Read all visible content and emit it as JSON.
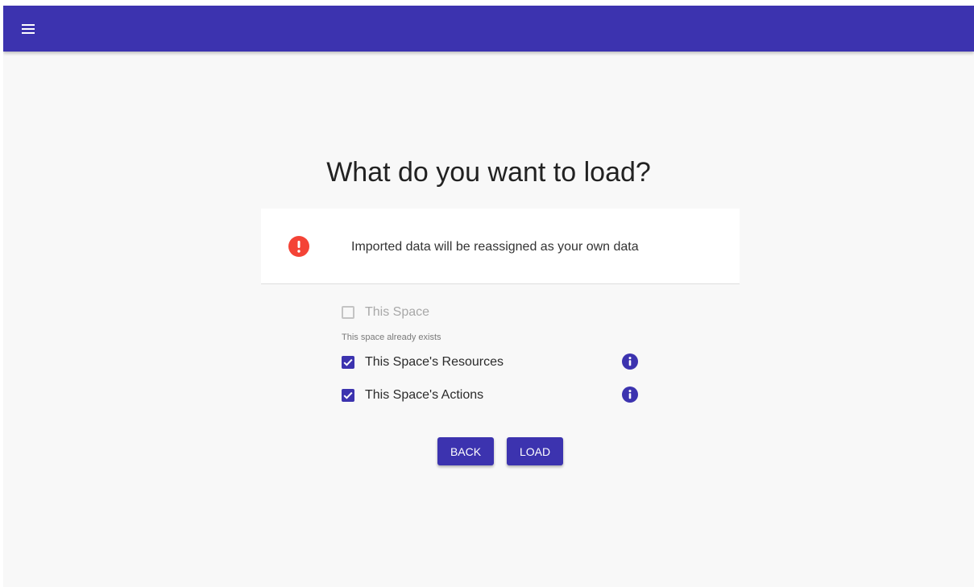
{
  "header": {
    "menu_icon": "hamburger-menu-icon",
    "color": "#3c33af"
  },
  "main": {
    "title": "What do you want to load?",
    "alert": {
      "icon": "error-circle-icon",
      "icon_color": "#f44336",
      "text": "Imported data will be reassigned as your own data"
    },
    "options": [
      {
        "label": "This Space",
        "checked": false,
        "disabled": true,
        "helper": "This space already exists"
      },
      {
        "label": "This Space's Resources",
        "checked": true,
        "disabled": false,
        "info_icon": "info-icon"
      },
      {
        "label": "This Space's Actions",
        "checked": true,
        "disabled": false,
        "info_icon": "info-icon"
      }
    ],
    "buttons": {
      "back": "BACK",
      "load": "LOAD"
    }
  },
  "colors": {
    "accent": "#3c33af",
    "error": "#f44336",
    "background": "#f8f8f8"
  }
}
